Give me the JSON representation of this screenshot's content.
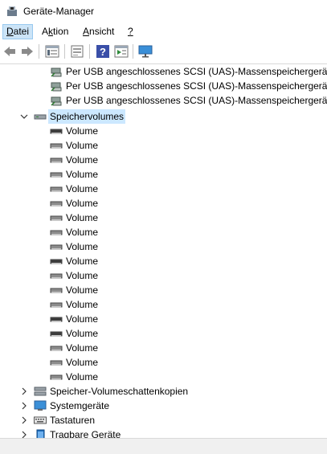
{
  "window": {
    "title": "Geräte-Manager"
  },
  "menu": {
    "items": [
      {
        "label": "Datei",
        "accel": "D"
      },
      {
        "label": "Aktion",
        "accel": "k"
      },
      {
        "label": "Ansicht",
        "accel": "A"
      },
      {
        "label": "?",
        "accel": "?"
      }
    ]
  },
  "toolbar": {
    "icons": [
      "back-arrow-icon",
      "forward-arrow-icon",
      "properties-icon",
      "driver-update-icon",
      "help-icon",
      "show-hidden-icon",
      "monitor-icon"
    ]
  },
  "tree": {
    "usb_devices": [
      "Per USB angeschlossenes SCSI (UAS)-Massenspeichergerät",
      "Per USB angeschlossenes SCSI (UAS)-Massenspeichergerät",
      "Per USB angeschlossenes SCSI (UAS)-Massenspeichergerät"
    ],
    "speichervolumes": {
      "label": "Speichervolumes",
      "expanded": true,
      "volumes": [
        "Volume",
        "Volume",
        "Volume",
        "Volume",
        "Volume",
        "Volume",
        "Volume",
        "Volume",
        "Volume",
        "Volume",
        "Volume",
        "Volume",
        "Volume",
        "Volume",
        "Volume",
        "Volume",
        "Volume",
        "Volume"
      ]
    },
    "categories_after": [
      {
        "label": "Speicher-Volumeschattenkopien",
        "icon": "storage-shadow-copy-icon"
      },
      {
        "label": "Systemgeräte",
        "icon": "system-devices-icon"
      },
      {
        "label": "Tastaturen",
        "icon": "keyboard-icon"
      },
      {
        "label": "Tragbare Geräte",
        "icon": "portable-device-icon"
      }
    ]
  },
  "colors": {
    "selection": "#cce8ff",
    "menu_active": "#cce4f7",
    "accent": "#0078d7"
  }
}
